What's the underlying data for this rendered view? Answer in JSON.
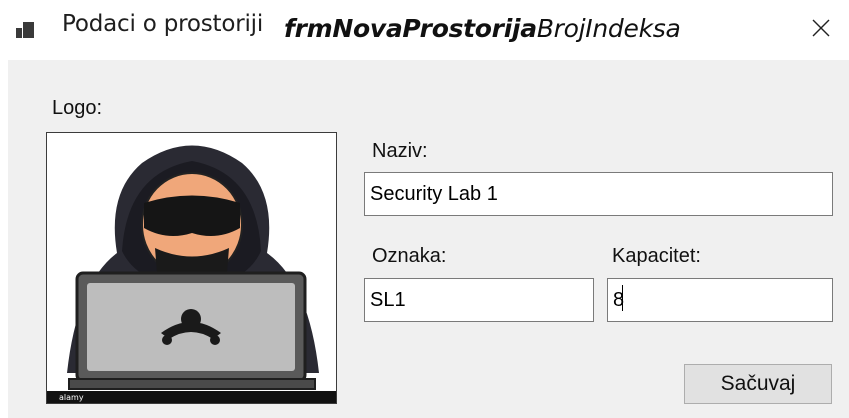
{
  "window": {
    "title": "Podaci o prostoriji",
    "form_name_bold": "frmNovaProstorija",
    "form_name_rest": "BrojIndeksa",
    "icon": "window-icon",
    "close_icon": "close-icon"
  },
  "logo": {
    "label": "Logo:",
    "image_desc": "hacker-with-laptop",
    "watermark": "alamy"
  },
  "fields": {
    "naziv": {
      "label": "Naziv:",
      "value": "Security Lab 1"
    },
    "oznaka": {
      "label": "Oznaka:",
      "value": "SL1"
    },
    "kapacitet": {
      "label": "Kapacitet:",
      "value": "8"
    }
  },
  "buttons": {
    "save_label": "Sačuvaj"
  },
  "colors": {
    "client_bg": "#f0f0f0",
    "button_bg": "#e1e1e1",
    "textbox_border": "#7a7a7a"
  }
}
